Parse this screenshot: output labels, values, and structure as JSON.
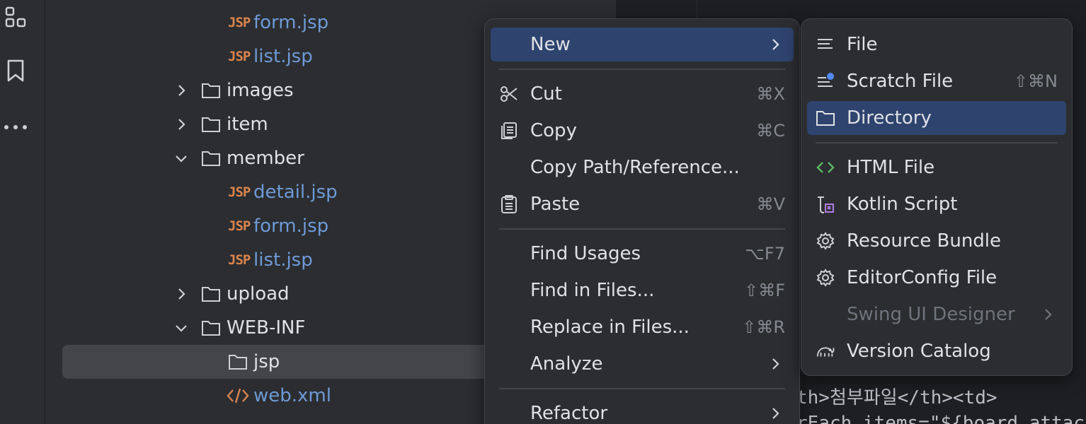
{
  "toolstrip": {
    "icons": [
      "structure-icon",
      "bookmark-icon",
      "more-icon"
    ]
  },
  "tree": {
    "rows": [
      {
        "type": "file",
        "badge": "JSP",
        "label": "form.jsp"
      },
      {
        "type": "file",
        "badge": "JSP",
        "label": "list.jsp"
      },
      {
        "type": "folder",
        "expanded": false,
        "label": "images"
      },
      {
        "type": "folder",
        "expanded": false,
        "label": "item"
      },
      {
        "type": "folder",
        "expanded": true,
        "label": "member"
      },
      {
        "type": "file",
        "badge": "JSP",
        "label": "detail.jsp"
      },
      {
        "type": "file",
        "badge": "JSP",
        "label": "form.jsp"
      },
      {
        "type": "file",
        "badge": "JSP",
        "label": "list.jsp"
      },
      {
        "type": "folder",
        "expanded": false,
        "label": "upload"
      },
      {
        "type": "folder",
        "expanded": true,
        "label": "WEB-INF"
      },
      {
        "type": "folder",
        "selected": true,
        "label": "jsp"
      },
      {
        "type": "xml",
        "label": "web.xml"
      }
    ]
  },
  "editor": {
    "line1": "th>첨부파일</th><td>",
    "line2": "rEach items=\"${board.attach"
  },
  "context_menu": {
    "items": [
      {
        "label": "New",
        "shortcut": "",
        "submenu": true,
        "active": true
      },
      {
        "label": "Cut",
        "shortcut": "⌘X",
        "icon": "scissors-icon"
      },
      {
        "label": "Copy",
        "shortcut": "⌘C",
        "icon": "copy-icon"
      },
      {
        "label": "Copy Path/Reference...",
        "shortcut": ""
      },
      {
        "label": "Paste",
        "shortcut": "⌘V",
        "icon": "clipboard-icon"
      },
      {
        "label": "Find Usages",
        "shortcut": "⌥F7"
      },
      {
        "label": "Find in Files...",
        "shortcut": "⇧⌘F"
      },
      {
        "label": "Replace in Files...",
        "shortcut": "⇧⌘R"
      },
      {
        "label": "Analyze",
        "shortcut": "",
        "submenu": true
      },
      {
        "label": "Refactor",
        "shortcut": "",
        "submenu": true
      }
    ]
  },
  "new_submenu": {
    "items": [
      {
        "label": "File",
        "shortcut": ""
      },
      {
        "label": "Scratch File",
        "shortcut": "⇧⌘N"
      },
      {
        "label": "Directory",
        "shortcut": "",
        "active": true
      },
      {
        "label": "HTML File",
        "shortcut": ""
      },
      {
        "label": "Kotlin Script",
        "shortcut": ""
      },
      {
        "label": "Resource Bundle",
        "shortcut": ""
      },
      {
        "label": "EditorConfig File",
        "shortcut": ""
      },
      {
        "label": "Swing UI Designer",
        "shortcut": "",
        "disabled": true,
        "submenu": true
      },
      {
        "label": "Version Catalog",
        "shortcut": ""
      }
    ]
  },
  "colors": {
    "background": "#2b2d30",
    "selection": "#2e436e",
    "file_text": "#6e9ad6",
    "jsp_badge": "#d9844e",
    "html_icon": "#5fb865",
    "kotlin_icon": "#b17ee3"
  }
}
